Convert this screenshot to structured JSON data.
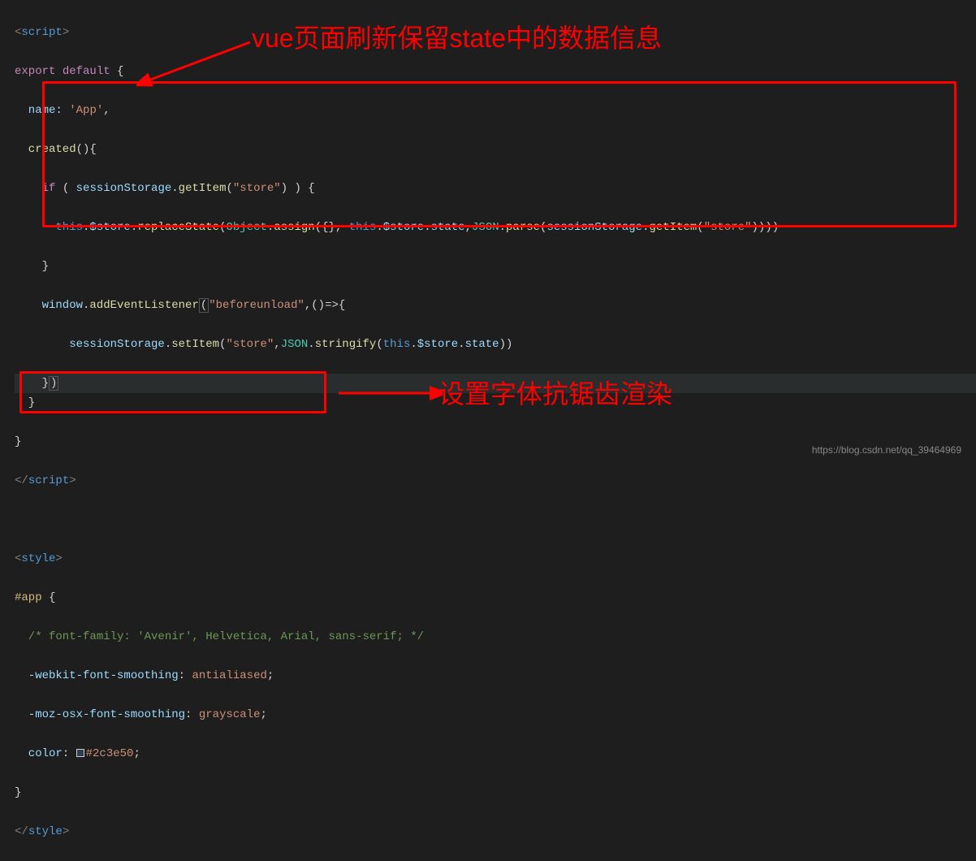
{
  "annotations": {
    "top": "vue页面刷新保留state中的数据信息",
    "bottom": "设置字体抗锯齿渲染"
  },
  "watermark": "https://blog.csdn.net/qq_39464969",
  "code": {
    "l1_open": "<",
    "l1_tag": "script",
    "l1_close": ">",
    "l2_export": "export",
    "l2_default": " default",
    "l2_brace": " {",
    "l3_name": "  name",
    "l3_colon": ": ",
    "l3_val": "'App'",
    "l3_comma": ",",
    "l4_created": "  created",
    "l4_paren": "(){",
    "l5_if": "    if",
    "l5_cond1": " ( ",
    "l5_ss": "sessionStorage",
    "l5_dot1": ".",
    "l5_getitem": "getItem",
    "l5_p1": "(",
    "l5_store": "\"store\"",
    "l5_p2": ") ) {",
    "l6_this": "      this",
    "l6_dot": ".",
    "l6_store": "$store",
    "l6_replacestate": "replaceState",
    "l6_object": "Object",
    "l6_assign": "assign",
    "l6_open": "({}, ",
    "l6_this2": "this",
    "l6_store2": "$store",
    "l6_state": "state",
    "l6_json": "JSON",
    "l6_parse": "parse",
    "l6_ss": "sessionStorage",
    "l6_getitem": "getItem",
    "l6_storestr": "\"store\"",
    "l6_close": "))))",
    "l7": "    }",
    "l8_window": "    window",
    "l8_ael": "addEventListener",
    "l8_bu": "\"beforeunload\"",
    "l8_arrow": ",()=>{",
    "l9_ss": "        sessionStorage",
    "l9_setitem": "setItem",
    "l9_store": "\"store\"",
    "l9_json": "JSON",
    "l9_stringify": "stringify",
    "l9_this": "this",
    "l9_store2": "$store",
    "l9_state": "state",
    "l9_close": "))",
    "l10": "    }",
    "l10b": ")",
    "l11": "  }",
    "l12": "}",
    "l13_open": "</",
    "l13_tag": "script",
    "l13_close": ">",
    "l15_open": "<",
    "l15_tag": "style",
    "l15_close": ">",
    "l16_sel": "#app",
    "l16_brace": " {",
    "l17": "  /* font-family: 'Avenir', Helvetica, Arial, sans-serif; */",
    "l18_prop": "  -webkit-font-smoothing",
    "l18_val": "antialiased",
    "l19_prop": "  -moz-osx-font-smoothing",
    "l19_val": "grayscale",
    "l20_prop": "  color",
    "l20_val": "#2c3e50",
    "l21": "}",
    "l22_open": "</",
    "l22_tag": "style",
    "l22_close": ">"
  }
}
